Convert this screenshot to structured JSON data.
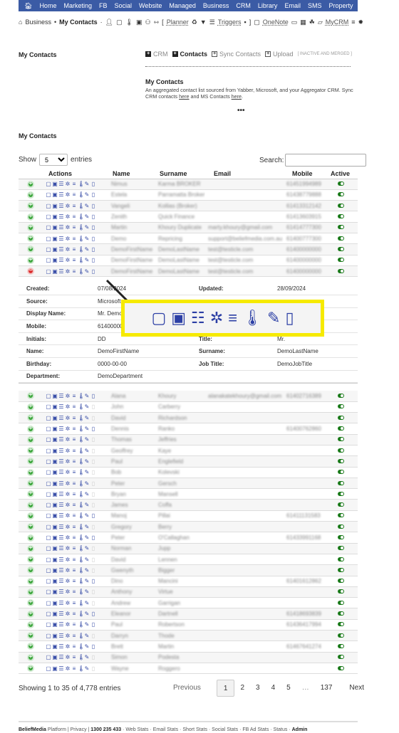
{
  "topnav": {
    "home_icon": "home-icon",
    "items": [
      "Home",
      "Marketing",
      "FB",
      "Social",
      "Website",
      "Managed",
      "Business",
      "CRM",
      "Library",
      "Email",
      "SMS",
      "Property"
    ],
    "settings_icon": "gear-icon"
  },
  "breadcrumb": {
    "home_icon": "home-icon",
    "section": "Business",
    "current": "My Contacts",
    "planner": "Planner",
    "triggers": "Triggers",
    "onenote": "OneNote",
    "mycrm": "MyCRM"
  },
  "page": {
    "title": "My Contacts",
    "tabs": [
      {
        "label": "CRM",
        "active": false
      },
      {
        "label": "Contacts",
        "active": true
      },
      {
        "label": "Sync Contacts",
        "active": false
      },
      {
        "label": "Upload",
        "active": false
      }
    ],
    "tabs_note": "[ INACTIVE AND MERGED ]",
    "desc_title": "My Contacts",
    "desc_text_1": "An aggregated contact list sourced from Yabber, Microsoft, and your Aggregator CRM. Sync CRM contacts ",
    "desc_link_1": "here",
    "desc_text_2": " and MS Contacts ",
    "desc_link_2": "here",
    "desc_text_3": ".",
    "ellipsis": "•••",
    "table_title": "My Contacts"
  },
  "table_controls": {
    "show_label": "Show",
    "page_size": "5",
    "entries_label": "entries",
    "search_label": "Search:",
    "search_value": ""
  },
  "columns": [
    "Actions",
    "Name",
    "Surname",
    "Email",
    "Mobile",
    "Active"
  ],
  "rows_top": [
    {
      "name": "Nimus",
      "surname": "Karma BROKER",
      "email": "",
      "mobile": "61451994989",
      "expanded": false,
      "mobile_icon": true
    },
    {
      "name": "Estela",
      "surname": "Parramatta Broker",
      "email": "",
      "mobile": "61438779888",
      "expanded": false,
      "mobile_icon": true
    },
    {
      "name": "Vangeli",
      "surname": "Kollias (Broker)",
      "email": "",
      "mobile": "61413312142",
      "expanded": false,
      "mobile_icon": true
    },
    {
      "name": "Zenith",
      "surname": "Quick Finance",
      "email": "",
      "mobile": "61413603915",
      "expanded": false,
      "mobile_icon": true
    },
    {
      "name": "Martin",
      "surname": "Khoury Duplicate",
      "email": "marty.khoury@gmail.com",
      "mobile": "61414777300",
      "expanded": false,
      "mobile_icon": true
    },
    {
      "name": "Demo",
      "surname": "Repricing",
      "email": "support@beliefmedia.com.au",
      "mobile": "61400777300",
      "expanded": false,
      "mobile_icon": true
    },
    {
      "name": "DemoFirstName",
      "surname": "DemoLastName",
      "email": "test@testicle.com",
      "mobile": "61400000000",
      "expanded": false,
      "mobile_icon": true
    },
    {
      "name": "DemoFirstName",
      "surname": "DemoLastName",
      "email": "test@testicle.com",
      "mobile": "61400000000",
      "expanded": false,
      "mobile_icon": true
    },
    {
      "name": "DemoFirstName",
      "surname": "DemoLastName",
      "email": "test@testicle.com",
      "mobile": "61400000000",
      "expanded": true,
      "mobile_icon": true
    }
  ],
  "detail": {
    "left": [
      {
        "label": "Created:",
        "value": "07/08/2024"
      },
      {
        "label": "Source:",
        "value": "Microsoft"
      },
      {
        "label": "Display Name:",
        "value": "Mr. DemoFirstName"
      },
      {
        "label": "Mobile:",
        "value": "61400000000"
      },
      {
        "label": "Initials:",
        "value": "DD"
      },
      {
        "label": "Name:",
        "value": "DemoFirstName"
      },
      {
        "label": "Birthday:",
        "value": "0000-00-00"
      },
      {
        "label": "Department:",
        "value": "DemoDepartment"
      }
    ],
    "right": [
      {
        "label": "Updated:",
        "value": "28/09/2024"
      },
      {
        "label": "",
        "value": ""
      },
      {
        "label": "",
        "value": ""
      },
      {
        "label": "",
        "value": ""
      },
      {
        "label": "Title:",
        "value": "Mr."
      },
      {
        "label": "Surname:",
        "value": "DemoLastName"
      },
      {
        "label": "Job Title:",
        "value": "DemoJobTitle"
      },
      {
        "label": "",
        "value": ""
      }
    ]
  },
  "action_icons": [
    {
      "name": "note-icon",
      "glyph": "▢"
    },
    {
      "name": "calendar-check-icon",
      "glyph": "▣"
    },
    {
      "name": "list-icon",
      "glyph": "☰"
    },
    {
      "name": "spinner-icon",
      "glyph": "✲"
    },
    {
      "name": "menu-bars-icon",
      "glyph": "≡"
    },
    {
      "name": "thermometer-icon",
      "glyph": "🌡"
    },
    {
      "name": "edit-icon",
      "glyph": "✎"
    },
    {
      "name": "mobile-icon",
      "glyph": "▯"
    }
  ],
  "overlay": {
    "highlight_color": "#f6ea00"
  },
  "rows_bottom": [
    {
      "name": "Alana",
      "surname": "Khoury",
      "email": "alanakatekhoury@gmail.com",
      "mobile": "61402716389",
      "mobile_icon": true
    },
    {
      "name": "John",
      "surname": "Carberry",
      "email": "",
      "mobile": "",
      "mobile_icon": false
    },
    {
      "name": "David",
      "surname": "Richardson",
      "email": "",
      "mobile": "",
      "mobile_icon": false
    },
    {
      "name": "Dennis",
      "surname": "Ranko",
      "email": "",
      "mobile": "61400762860",
      "mobile_icon": true
    },
    {
      "name": "Thomas",
      "surname": "Jeffries",
      "email": "",
      "mobile": "",
      "mobile_icon": false
    },
    {
      "name": "Geoffrey",
      "surname": "Kaye",
      "email": "",
      "mobile": "",
      "mobile_icon": false
    },
    {
      "name": "Paul",
      "surname": "Englefield",
      "email": "",
      "mobile": "",
      "mobile_icon": false
    },
    {
      "name": "Bob",
      "surname": "Kolevski",
      "email": "",
      "mobile": "",
      "mobile_icon": false
    },
    {
      "name": "Peter",
      "surname": "Gersch",
      "email": "",
      "mobile": "",
      "mobile_icon": false
    },
    {
      "name": "Bryan",
      "surname": "Mansell",
      "email": "",
      "mobile": "",
      "mobile_icon": false
    },
    {
      "name": "James",
      "surname": "Coffa",
      "email": "",
      "mobile": "",
      "mobile_icon": false
    },
    {
      "name": "Manoj",
      "surname": "Pillai",
      "email": "",
      "mobile": "61411131583",
      "mobile_icon": true
    },
    {
      "name": "Gregory",
      "surname": "Berry",
      "email": "",
      "mobile": "",
      "mobile_icon": false
    },
    {
      "name": "Peter",
      "surname": "O'Callaghan",
      "email": "",
      "mobile": "61433991168",
      "mobile_icon": true
    },
    {
      "name": "Norman",
      "surname": "Jupp",
      "email": "",
      "mobile": "",
      "mobile_icon": false
    },
    {
      "name": "David",
      "surname": "Lennen",
      "email": "",
      "mobile": "",
      "mobile_icon": false
    },
    {
      "name": "Gwenyth",
      "surname": "Bigger",
      "email": "",
      "mobile": "",
      "mobile_icon": false
    },
    {
      "name": "Dino",
      "surname": "Mancini",
      "email": "",
      "mobile": "61401612862",
      "mobile_icon": true
    },
    {
      "name": "Anthony",
      "surname": "Virtue",
      "email": "",
      "mobile": "",
      "mobile_icon": false
    },
    {
      "name": "Andrew",
      "surname": "Garrigan",
      "email": "",
      "mobile": "",
      "mobile_icon": false
    },
    {
      "name": "Eleanor",
      "surname": "Dartnell",
      "email": "",
      "mobile": "61418693839",
      "mobile_icon": true
    },
    {
      "name": "Paul",
      "surname": "Robertson",
      "email": "",
      "mobile": "61436417994",
      "mobile_icon": true
    },
    {
      "name": "Darryn",
      "surname": "Thode",
      "email": "",
      "mobile": "",
      "mobile_icon": false
    },
    {
      "name": "Brett",
      "surname": "Martin",
      "email": "",
      "mobile": "61467641274",
      "mobile_icon": true
    },
    {
      "name": "Simon",
      "surname": "Podesta",
      "email": "",
      "mobile": "",
      "mobile_icon": false
    },
    {
      "name": "Wayne",
      "surname": "Roggero",
      "email": "",
      "mobile": "",
      "mobile_icon": false
    }
  ],
  "pagination": {
    "info": "Showing 1 to 35 of 4,778 entries",
    "previous": "Previous",
    "pages": [
      "1",
      "2",
      "3",
      "4",
      "5",
      "…",
      "137"
    ],
    "current": "1",
    "next": "Next"
  },
  "footer": {
    "brand": "BeliefMedia",
    "text": " Platform | Privacy | ",
    "phone": "1300 235 433",
    "links": " · Web Stats · Email Stats · Short Stats · Social Stats · FB Ad Stats · Status · ",
    "admin": "Admin"
  }
}
